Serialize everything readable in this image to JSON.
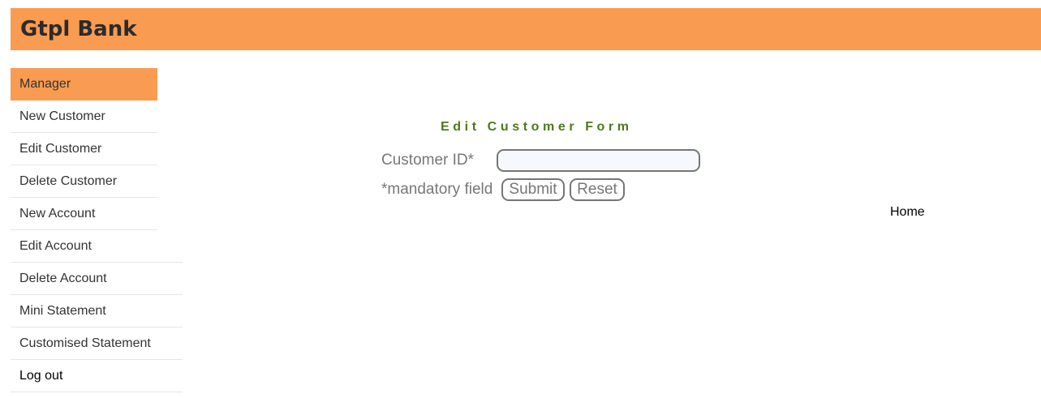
{
  "header": {
    "title": "Gtpl Bank",
    "background_color": "#f99b50"
  },
  "sidebar": {
    "items": [
      {
        "label": "Manager",
        "active": true
      },
      {
        "label": "New Customer"
      },
      {
        "label": "Edit Customer"
      },
      {
        "label": "Delete Customer"
      },
      {
        "label": "New Account"
      },
      {
        "label": "Edit Account"
      },
      {
        "label": "Delete Account"
      },
      {
        "label": "Mini Statement"
      },
      {
        "label": "Customised Statement"
      },
      {
        "label": "Log out"
      }
    ],
    "active_color": "#f99b50"
  },
  "form": {
    "title": "Edit Customer Form",
    "title_color": "#4d7a1b",
    "customer_id_label": "Customer ID*",
    "customer_id_value": "",
    "mandatory_note": "*mandatory field",
    "submit_label": "Submit",
    "reset_label": "Reset"
  },
  "links": {
    "home": "Home"
  }
}
